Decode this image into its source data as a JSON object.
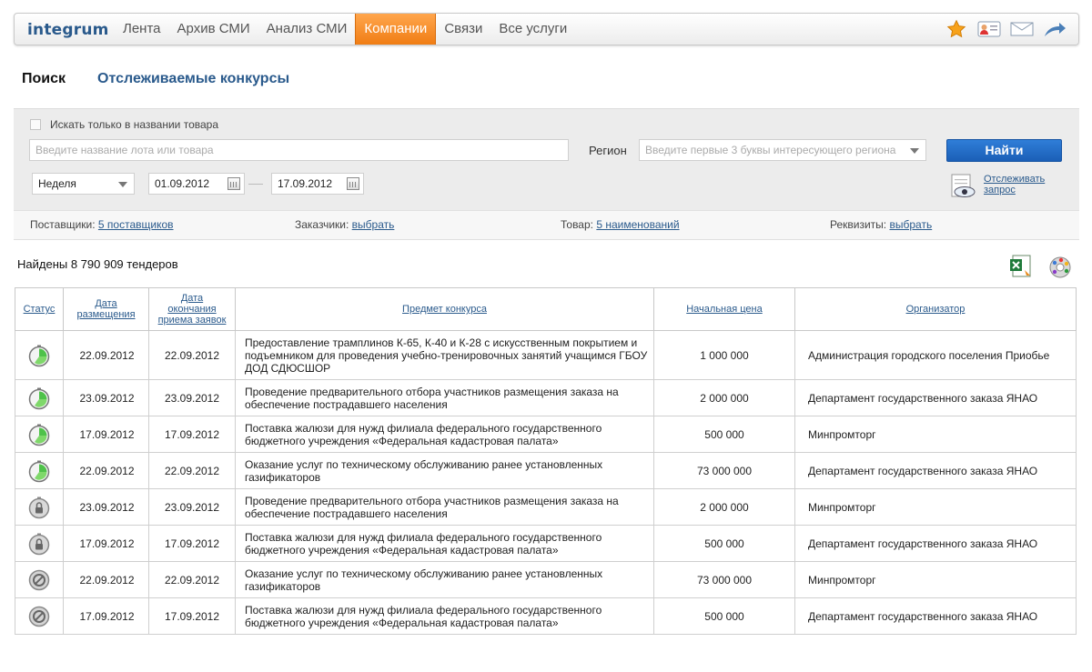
{
  "app": {
    "logo": "integrum"
  },
  "nav": {
    "items": [
      "Лента",
      "Архив СМИ",
      "Анализ СМИ",
      "Компании",
      "Связи",
      "Все услуги"
    ],
    "active_index": 3,
    "icons": [
      "star-icon",
      "contact-card-icon",
      "mail-icon",
      "share-arrow-icon"
    ],
    "accent_color": "#f28a1f"
  },
  "tabs": {
    "search": "Поиск",
    "tracked": "Отслеживаемые конкурсы"
  },
  "search": {
    "title_only_label": "Искать только в названии товара",
    "title_only_checked": false,
    "query_placeholder": "Введите название лота или товара",
    "query_value": "",
    "region_label": "Регион",
    "region_placeholder": "Введите первые 3 буквы интересующего региона",
    "find_button": "Найти",
    "period": "Неделя",
    "date_from": "01.09.2012",
    "date_to": "17.09.2012",
    "track_label": "Отслеживать запрос"
  },
  "filters": {
    "suppliers_label": "Поставщики:",
    "suppliers_value": "5 поставщиков",
    "customers_label": "Заказчики:",
    "customers_value": "выбрать",
    "goods_label": "Товар:",
    "goods_value": "5 наименований",
    "requisites_label": "Реквизиты:",
    "requisites_value": "выбрать"
  },
  "results": {
    "found_text": "Найдены 8 790 909 тендеров"
  },
  "table": {
    "headers": {
      "status": "Статус",
      "date_posted": "Дата размещения",
      "date_end": "Дата окончания приема заявок",
      "subject": "Предмет конкурса",
      "price": "Начальная цена",
      "organizer": "Организатор"
    },
    "rows": [
      {
        "status": "active",
        "posted": "22.09.2012",
        "end": "22.09.2012",
        "subject": "Предоставление трамплинов К-65, К-40 и К-28 с искусственным покрытием и подъемником для проведения учебно-тренировочных занятий учащимся ГБОУ ДОД СДЮСШОР",
        "price": "1 000 000",
        "org": "Администрация городского поселения Приобье"
      },
      {
        "status": "active",
        "posted": "23.09.2012",
        "end": "23.09.2012",
        "subject": "Проведение предварительного отбора участников размещения заказа на обеспечение пострадавшего населения",
        "price": "2 000 000",
        "org": "Департамент государственного заказа ЯНАО"
      },
      {
        "status": "active",
        "posted": "17.09.2012",
        "end": "17.09.2012",
        "subject": "Поставка жалюзи для нужд филиала федерального государственного бюджетного учреждения «Федеральная кадастровая палата»",
        "price": "500 000",
        "org": "Минпромторг"
      },
      {
        "status": "active",
        "posted": "22.09.2012",
        "end": "22.09.2012",
        "subject": "Оказание услуг по техническому обслуживанию ранее установленных газификаторов",
        "price": "73 000 000",
        "org": "Департамент государственного заказа ЯНАО"
      },
      {
        "status": "locked",
        "posted": "23.09.2012",
        "end": "23.09.2012",
        "subject": "Проведение предварительного отбора участников размещения заказа на обеспечение пострадавшего населения",
        "price": "2 000 000",
        "org": "Минпромторг"
      },
      {
        "status": "locked",
        "posted": "17.09.2012",
        "end": "17.09.2012",
        "subject": "Поставка жалюзи для нужд филиала федерального государственного бюджетного учреждения «Федеральная кадастровая палата»",
        "price": "500 000",
        "org": "Департамент государственного заказа ЯНАО"
      },
      {
        "status": "cancelled",
        "posted": "22.09.2012",
        "end": "22.09.2012",
        "subject": "Оказание услуг по техническому обслуживанию ранее установленных газификаторов",
        "price": "73 000 000",
        "org": "Минпромторг"
      },
      {
        "status": "cancelled",
        "posted": "17.09.2012",
        "end": "17.09.2012",
        "subject": "Поставка жалюзи для нужд филиала федерального государственного бюджетного учреждения «Федеральная кадастровая палата»",
        "price": "500 000",
        "org": "Департамент государственного заказа ЯНАО"
      }
    ]
  }
}
